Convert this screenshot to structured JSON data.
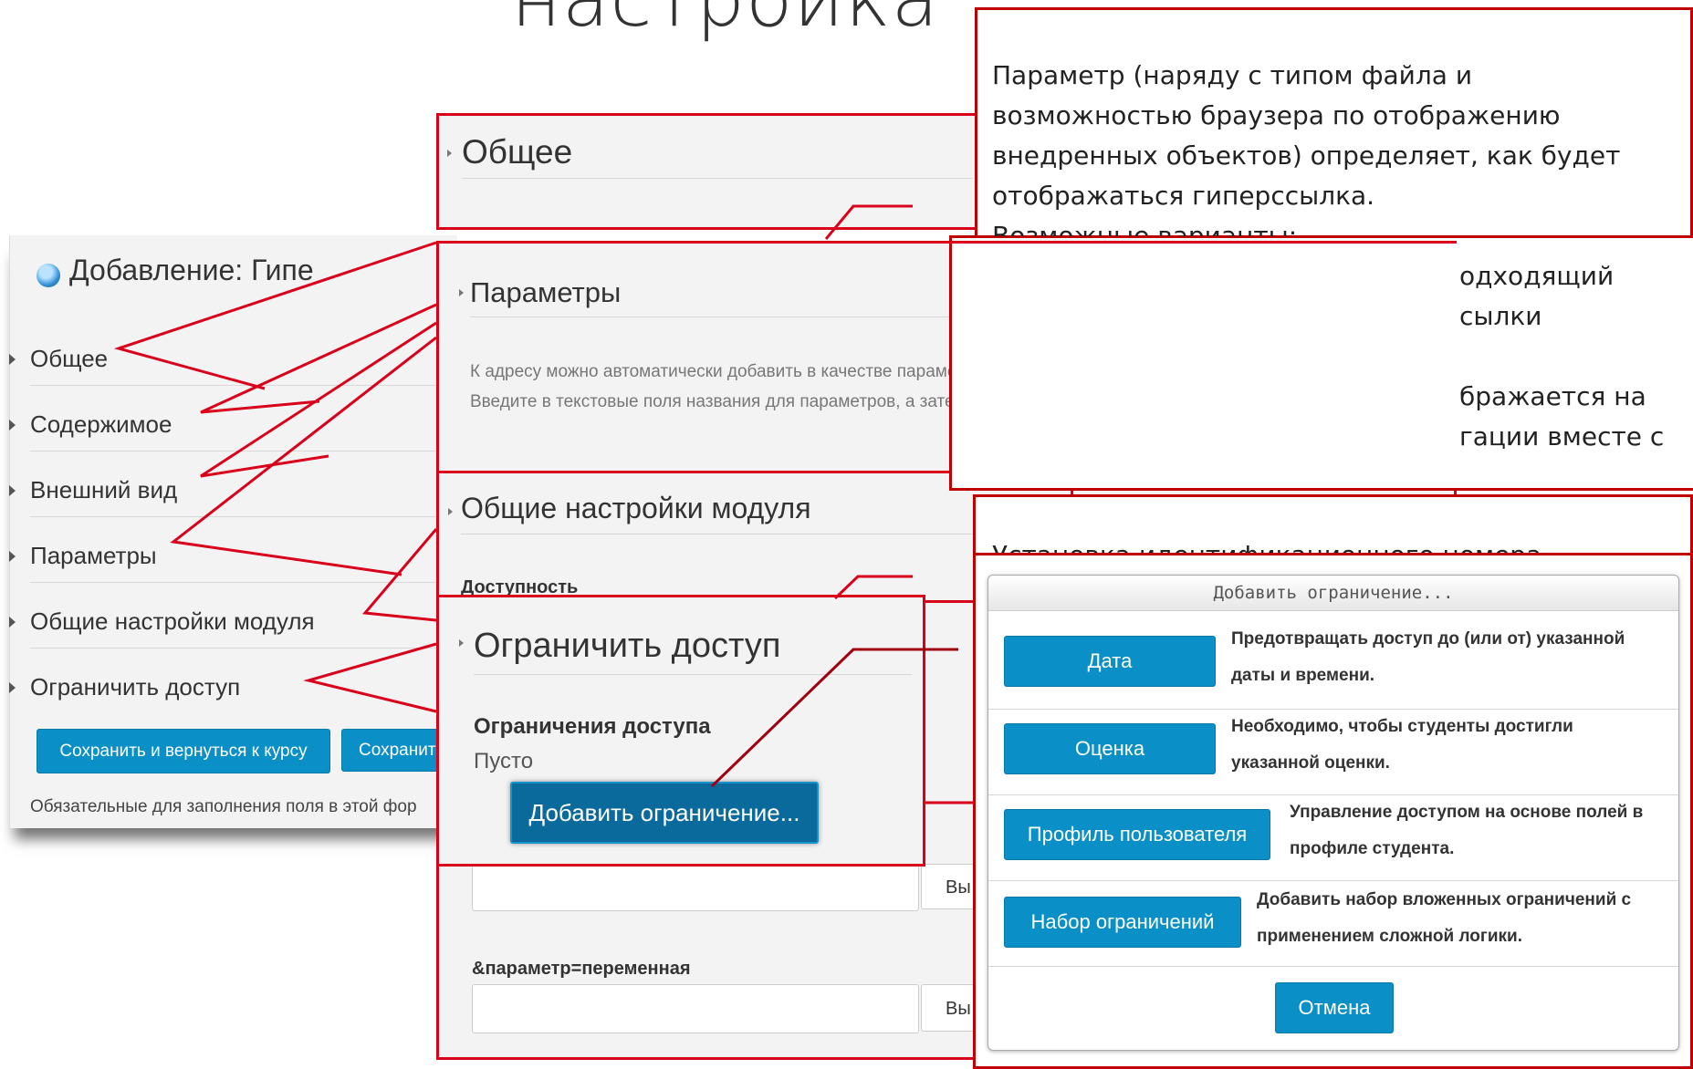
{
  "slide_title": "настройка",
  "main_panel": {
    "title": "Добавление: Гипе",
    "sections": [
      "Общее",
      "Содержимое",
      "Внешний вид",
      "Параметры",
      "Общие настройки модуля",
      "Ограничить доступ"
    ],
    "save_return_label": "Сохранить и вернуться к курсу",
    "save_show_label": "Сохранит",
    "required_note": "Обязательные для заполнения поля в этой фор"
  },
  "general_panel": {
    "heading": "Общее"
  },
  "params_panel": {
    "heading": "Параметры",
    "description": "К адресу можно автоматически добавить в качестве параметров значения некоторых внутренних переменных Moodle. Введите в текстовые поля названия для параметров, а затем выберите соответствующие переменные.",
    "param_label": "&параметр=переменная",
    "select_label_1": "Вы",
    "select_label_2": "Вы"
  },
  "module_panel": {
    "heading": "Общие настройки модуля",
    "availability_label": "Доступность"
  },
  "restrict_panel": {
    "heading": "Ограничить доступ",
    "restrictions_label": "Ограничения доступа",
    "empty_label": "Пусто",
    "add_button": "Добавить ограничение..."
  },
  "callout_display": {
    "lines": [
      "Параметр (наряду с типом файла и",
      "возможностью браузера по отображению",
      "внедренных объектов) определяет, как будет",
      "отображаться гиперссылка.",
      "Возможные варианты:"
    ]
  },
  "callout_partial": {
    "lines": [
      "одходящий",
      "сылки",
      "",
      "бражается на",
      "гации вместе с"
    ]
  },
  "callout_idnumber": {
    "text": "Установка идентификационного номера"
  },
  "modal": {
    "title": "Добавить ограничение...",
    "options": [
      {
        "button": "Дата",
        "line1": "Предотвращать доступ до (или от) указанной",
        "line2": "даты и времени."
      },
      {
        "button": "Оценка",
        "line1": "Необходимо, чтобы студенты достигли",
        "line2": "указанной оценки."
      },
      {
        "button": "Профиль пользователя",
        "line1": "Управление доступом на основе полей в",
        "line2": "профиле студента."
      },
      {
        "button": "Набор ограничений",
        "line1": "Добавить набор вложенных ограничений с",
        "line2": "применением сложной логики."
      }
    ],
    "cancel_label": "Отмена"
  },
  "colors": {
    "accent_red": "#d9001b",
    "button_blue": "#0a8fc7",
    "panel_bg": "#f3f3f3"
  }
}
